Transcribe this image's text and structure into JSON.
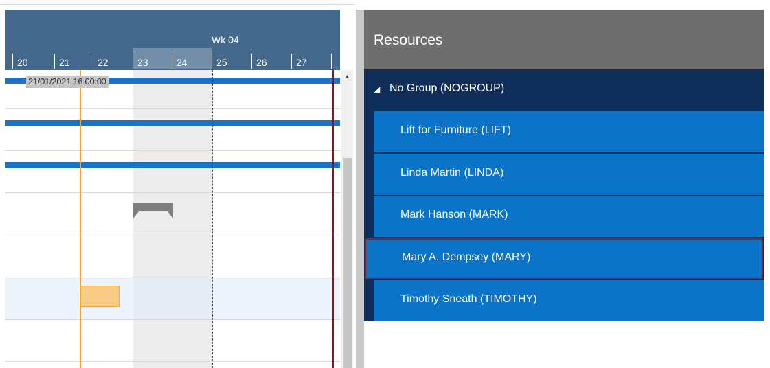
{
  "timeline": {
    "week_label": "Wk 04",
    "days": [
      "20",
      "21",
      "22",
      "23",
      "24",
      "25",
      "26",
      "27"
    ],
    "weekend_days": [
      "23",
      "24"
    ],
    "current_time_tooltip": "21/01/2021 16:00:00"
  },
  "resources": {
    "title": "Resources",
    "group": {
      "expand_glyph": "◢",
      "label": "No Group (NOGROUP)"
    },
    "items": [
      {
        "label": "Lift for Furniture (LIFT)"
      },
      {
        "label": "Linda Martin (LINDA)"
      },
      {
        "label": "Mark Hanson (MARK)"
      },
      {
        "label": "Mary A. Dempsey (MARY)",
        "selected": true
      },
      {
        "label": "Timothy Sneath (TIMOTHY)"
      }
    ]
  },
  "colors": {
    "timeline_header": "#44698d",
    "booking_bar": "#1a73c8",
    "current_time_line": "#f5a623",
    "resource_row": "#0b74c8",
    "group_row": "#0f2e5a",
    "panel_header": "#6e6e6e"
  },
  "icons": {
    "scroll_up": "scroll-up-arrow-icon",
    "group_expand": "triangle-expand-icon"
  }
}
